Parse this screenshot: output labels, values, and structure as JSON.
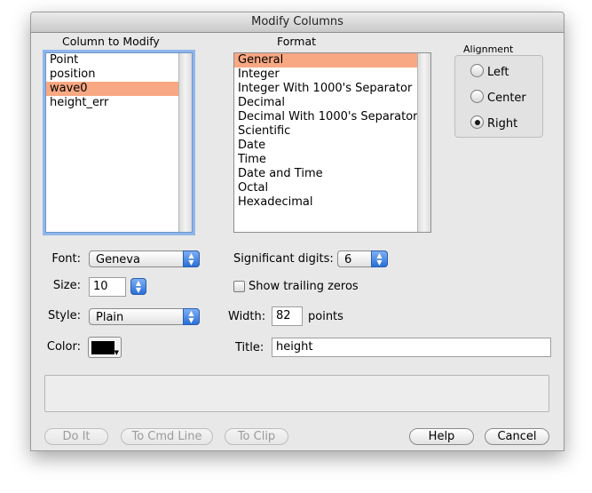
{
  "window": {
    "title": "Modify Columns"
  },
  "column_list": {
    "header": "Column to Modify",
    "items": [
      "Point",
      "position",
      "wave0",
      "height_err"
    ],
    "selected_index": 2
  },
  "format_list": {
    "header": "Format",
    "items": [
      "General",
      "Integer",
      "Integer With 1000's Separator",
      "Decimal",
      "Decimal With 1000's Separator",
      "Scientific",
      "Date",
      "Time",
      "Date and Time",
      "Octal",
      "Hexadecimal"
    ],
    "selected_index": 0
  },
  "alignment": {
    "header": "Alignment",
    "options": [
      "Left",
      "Center",
      "Right"
    ],
    "selected": "Right"
  },
  "font": {
    "label": "Font:",
    "value": "Geneva"
  },
  "size": {
    "label": "Size:",
    "value": "10"
  },
  "style": {
    "label": "Style:",
    "value": "Plain"
  },
  "color": {
    "label": "Color:",
    "swatch": "#000000"
  },
  "significant_digits": {
    "label": "Significant digits:",
    "value": "6"
  },
  "trailing_zeros": {
    "label": "Show trailing zeros",
    "checked": false
  },
  "width": {
    "label": "Width:",
    "value": "82",
    "unit": "points"
  },
  "title_field": {
    "label": "Title:",
    "value": "height"
  },
  "buttons": {
    "do_it": "Do It",
    "to_cmd_line": "To Cmd Line",
    "to_clip": "To Clip",
    "help": "Help",
    "cancel": "Cancel"
  },
  "colors": {
    "selection": "#f8a883",
    "focus_ring": "#8fb6ea",
    "popup_arrow": "#2a6fd8"
  }
}
